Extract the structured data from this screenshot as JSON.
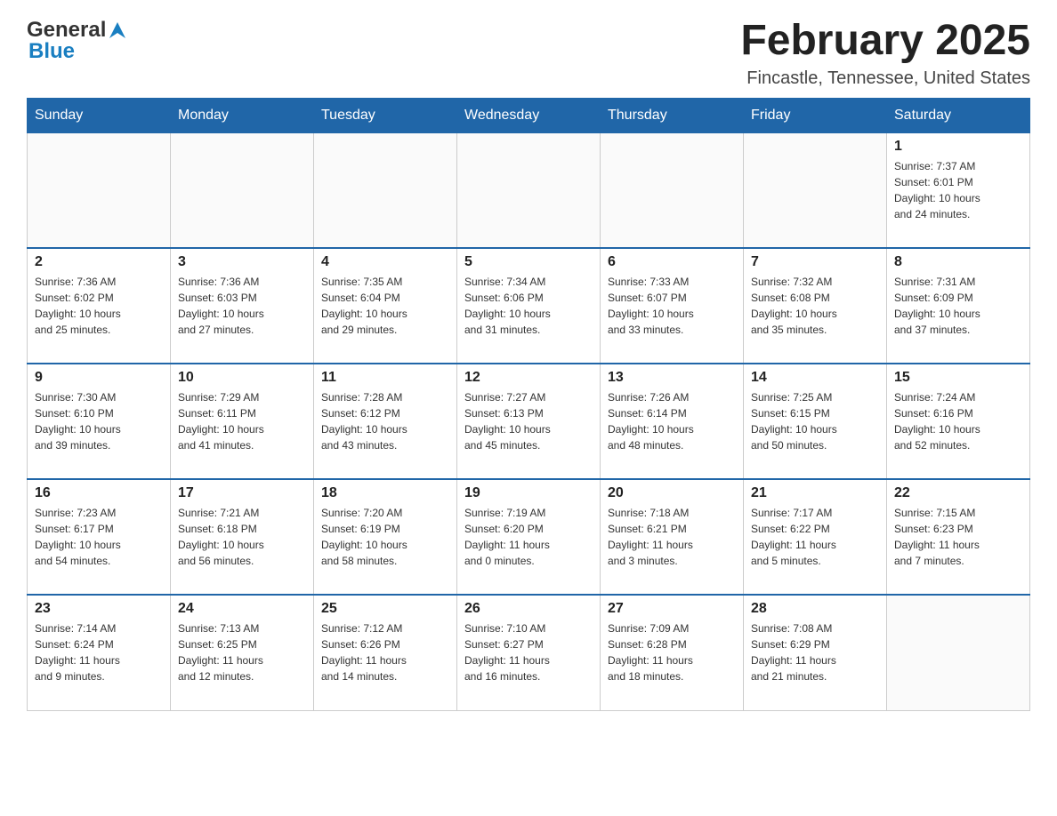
{
  "header": {
    "logo_general": "General",
    "logo_blue": "Blue",
    "month_title": "February 2025",
    "location": "Fincastle, Tennessee, United States"
  },
  "days_of_week": [
    "Sunday",
    "Monday",
    "Tuesday",
    "Wednesday",
    "Thursday",
    "Friday",
    "Saturday"
  ],
  "weeks": [
    {
      "days": [
        {
          "number": "",
          "info": ""
        },
        {
          "number": "",
          "info": ""
        },
        {
          "number": "",
          "info": ""
        },
        {
          "number": "",
          "info": ""
        },
        {
          "number": "",
          "info": ""
        },
        {
          "number": "",
          "info": ""
        },
        {
          "number": "1",
          "info": "Sunrise: 7:37 AM\nSunset: 6:01 PM\nDaylight: 10 hours\nand 24 minutes."
        }
      ]
    },
    {
      "days": [
        {
          "number": "2",
          "info": "Sunrise: 7:36 AM\nSunset: 6:02 PM\nDaylight: 10 hours\nand 25 minutes."
        },
        {
          "number": "3",
          "info": "Sunrise: 7:36 AM\nSunset: 6:03 PM\nDaylight: 10 hours\nand 27 minutes."
        },
        {
          "number": "4",
          "info": "Sunrise: 7:35 AM\nSunset: 6:04 PM\nDaylight: 10 hours\nand 29 minutes."
        },
        {
          "number": "5",
          "info": "Sunrise: 7:34 AM\nSunset: 6:06 PM\nDaylight: 10 hours\nand 31 minutes."
        },
        {
          "number": "6",
          "info": "Sunrise: 7:33 AM\nSunset: 6:07 PM\nDaylight: 10 hours\nand 33 minutes."
        },
        {
          "number": "7",
          "info": "Sunrise: 7:32 AM\nSunset: 6:08 PM\nDaylight: 10 hours\nand 35 minutes."
        },
        {
          "number": "8",
          "info": "Sunrise: 7:31 AM\nSunset: 6:09 PM\nDaylight: 10 hours\nand 37 minutes."
        }
      ]
    },
    {
      "days": [
        {
          "number": "9",
          "info": "Sunrise: 7:30 AM\nSunset: 6:10 PM\nDaylight: 10 hours\nand 39 minutes."
        },
        {
          "number": "10",
          "info": "Sunrise: 7:29 AM\nSunset: 6:11 PM\nDaylight: 10 hours\nand 41 minutes."
        },
        {
          "number": "11",
          "info": "Sunrise: 7:28 AM\nSunset: 6:12 PM\nDaylight: 10 hours\nand 43 minutes."
        },
        {
          "number": "12",
          "info": "Sunrise: 7:27 AM\nSunset: 6:13 PM\nDaylight: 10 hours\nand 45 minutes."
        },
        {
          "number": "13",
          "info": "Sunrise: 7:26 AM\nSunset: 6:14 PM\nDaylight: 10 hours\nand 48 minutes."
        },
        {
          "number": "14",
          "info": "Sunrise: 7:25 AM\nSunset: 6:15 PM\nDaylight: 10 hours\nand 50 minutes."
        },
        {
          "number": "15",
          "info": "Sunrise: 7:24 AM\nSunset: 6:16 PM\nDaylight: 10 hours\nand 52 minutes."
        }
      ]
    },
    {
      "days": [
        {
          "number": "16",
          "info": "Sunrise: 7:23 AM\nSunset: 6:17 PM\nDaylight: 10 hours\nand 54 minutes."
        },
        {
          "number": "17",
          "info": "Sunrise: 7:21 AM\nSunset: 6:18 PM\nDaylight: 10 hours\nand 56 minutes."
        },
        {
          "number": "18",
          "info": "Sunrise: 7:20 AM\nSunset: 6:19 PM\nDaylight: 10 hours\nand 58 minutes."
        },
        {
          "number": "19",
          "info": "Sunrise: 7:19 AM\nSunset: 6:20 PM\nDaylight: 11 hours\nand 0 minutes."
        },
        {
          "number": "20",
          "info": "Sunrise: 7:18 AM\nSunset: 6:21 PM\nDaylight: 11 hours\nand 3 minutes."
        },
        {
          "number": "21",
          "info": "Sunrise: 7:17 AM\nSunset: 6:22 PM\nDaylight: 11 hours\nand 5 minutes."
        },
        {
          "number": "22",
          "info": "Sunrise: 7:15 AM\nSunset: 6:23 PM\nDaylight: 11 hours\nand 7 minutes."
        }
      ]
    },
    {
      "days": [
        {
          "number": "23",
          "info": "Sunrise: 7:14 AM\nSunset: 6:24 PM\nDaylight: 11 hours\nand 9 minutes."
        },
        {
          "number": "24",
          "info": "Sunrise: 7:13 AM\nSunset: 6:25 PM\nDaylight: 11 hours\nand 12 minutes."
        },
        {
          "number": "25",
          "info": "Sunrise: 7:12 AM\nSunset: 6:26 PM\nDaylight: 11 hours\nand 14 minutes."
        },
        {
          "number": "26",
          "info": "Sunrise: 7:10 AM\nSunset: 6:27 PM\nDaylight: 11 hours\nand 16 minutes."
        },
        {
          "number": "27",
          "info": "Sunrise: 7:09 AM\nSunset: 6:28 PM\nDaylight: 11 hours\nand 18 minutes."
        },
        {
          "number": "28",
          "info": "Sunrise: 7:08 AM\nSunset: 6:29 PM\nDaylight: 11 hours\nand 21 minutes."
        },
        {
          "number": "",
          "info": ""
        }
      ]
    }
  ]
}
